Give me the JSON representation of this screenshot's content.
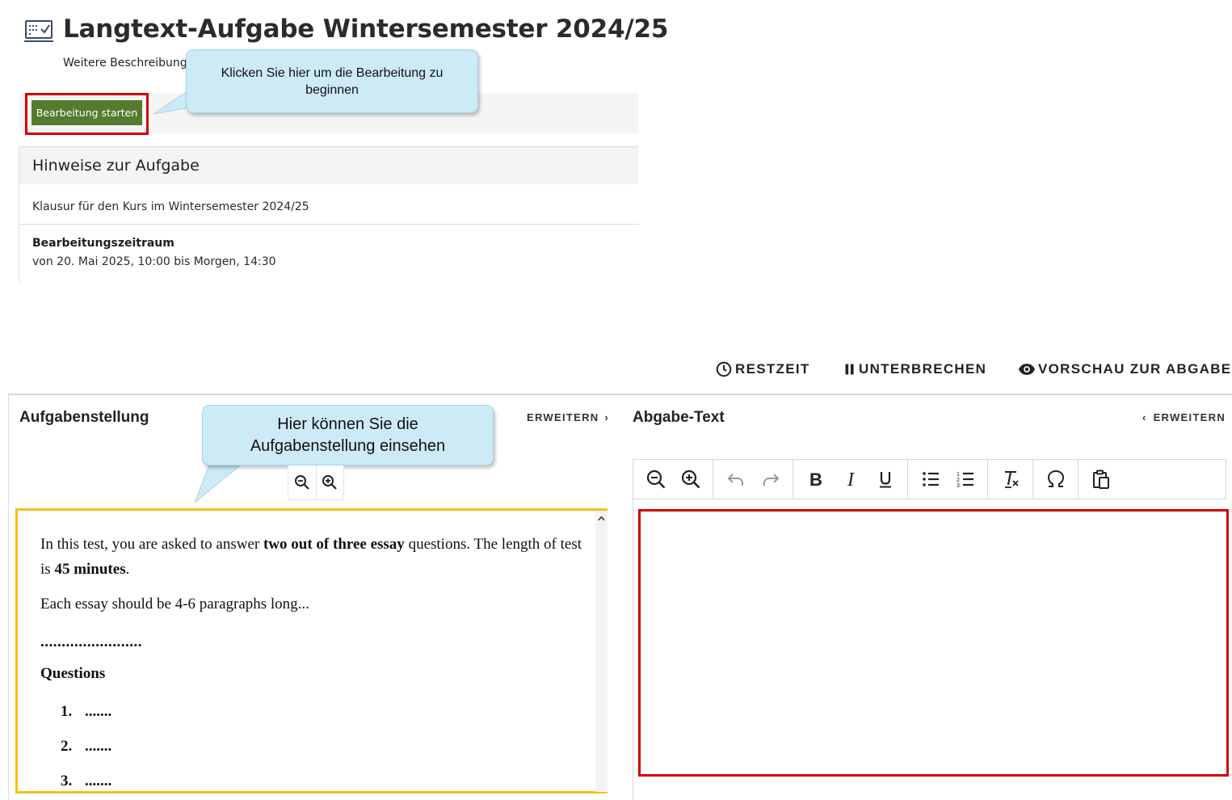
{
  "header": {
    "title": "Langtext-Aufgabe Wintersemester 2024/25",
    "description": "Weitere Beschreibung"
  },
  "start": {
    "button_label": "Bearbeitung starten"
  },
  "callouts": {
    "start_hint": "Klicken Sie hier um die Bearbeitung zu beginnen",
    "task_hint": "Hier können Sie die Aufgabenstellung einsehen"
  },
  "info": {
    "title": "Hinweise zur Aufgabe",
    "course": "Klausur für den Kurs im Wintersemester 2024/25",
    "period_label": "Bearbeitungszeitraum",
    "period_value": "von 20. Mai 2025, 10:00 bis Morgen, 14:30"
  },
  "actions": {
    "remaining": "RESTZEIT",
    "pause": "UNTERBRECHEN",
    "preview": "VORSCHAU ZUR ABGABE"
  },
  "task_pane": {
    "title": "Aufgabenstellung",
    "expand": "ERWEITERN",
    "expand_glyph": "›",
    "content": {
      "p1_a": "In this test, you are asked to answer ",
      "p1_b": "two out of three essay",
      "p1_c": " questions. The length of test is ",
      "p1_d": "45 minutes",
      "p1_e": ".",
      "p2": "Each essay should be 4-6 paragraphs long...",
      "dots": "........................",
      "questions_heading": "Questions",
      "questions": [
        {
          "num": "1.",
          "text": "......."
        },
        {
          "num": "2.",
          "text": "......."
        },
        {
          "num": "3.",
          "text": "......."
        }
      ]
    }
  },
  "submission_pane": {
    "title": "Abgabe-Text",
    "expand": "ERWEITERN",
    "expand_glyph": "‹"
  },
  "icons": {
    "title": "task-list-icon",
    "remaining": "clock-icon",
    "pause": "pause-icon",
    "preview": "eye-icon"
  },
  "colors": {
    "start_button": "#557b2e",
    "highlight_red": "#d40000",
    "highlight_yellow": "#f6bf1c",
    "callout_fill": "#cdeaf7"
  }
}
